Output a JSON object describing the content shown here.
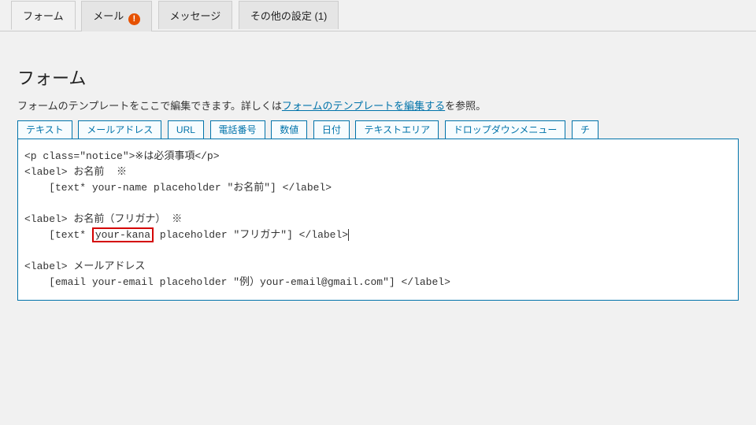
{
  "tabs": [
    {
      "label": "フォーム",
      "active": true
    },
    {
      "label": "メール",
      "warn": true
    },
    {
      "label": "メッセージ"
    },
    {
      "label": "その他の設定 (1)"
    }
  ],
  "panel": {
    "title": "フォーム",
    "desc_prefix": "フォームのテンプレートをここで編集できます。詳しくは",
    "desc_link": "フォームのテンプレートを編集する",
    "desc_suffix": "を参照。"
  },
  "tag_buttons": [
    "テキスト",
    "メールアドレス",
    "URL",
    "電話番号",
    "数値",
    "日付",
    "テキストエリア",
    "ドロップダウンメニュー",
    "チ"
  ],
  "code": {
    "line1": "<p class=\"notice\">※は必須事項</p>",
    "line2": "<label> お名前  ※",
    "line3": "    [text* your-name placeholder \"お名前\"] </label>",
    "line4": "",
    "line5": "<label> お名前（フリガナ） ※",
    "line6_pre": "    [text* ",
    "line6_hl": "your-kana",
    "line6_post": " placeholder \"フリガナ\"] </label>",
    "line7": "",
    "line8": "<label> メールアドレス",
    "line9": "    [email your-email placeholder \"例）your-email@gmail.com\"] </label>"
  },
  "icons": {
    "warn_glyph": "!"
  }
}
